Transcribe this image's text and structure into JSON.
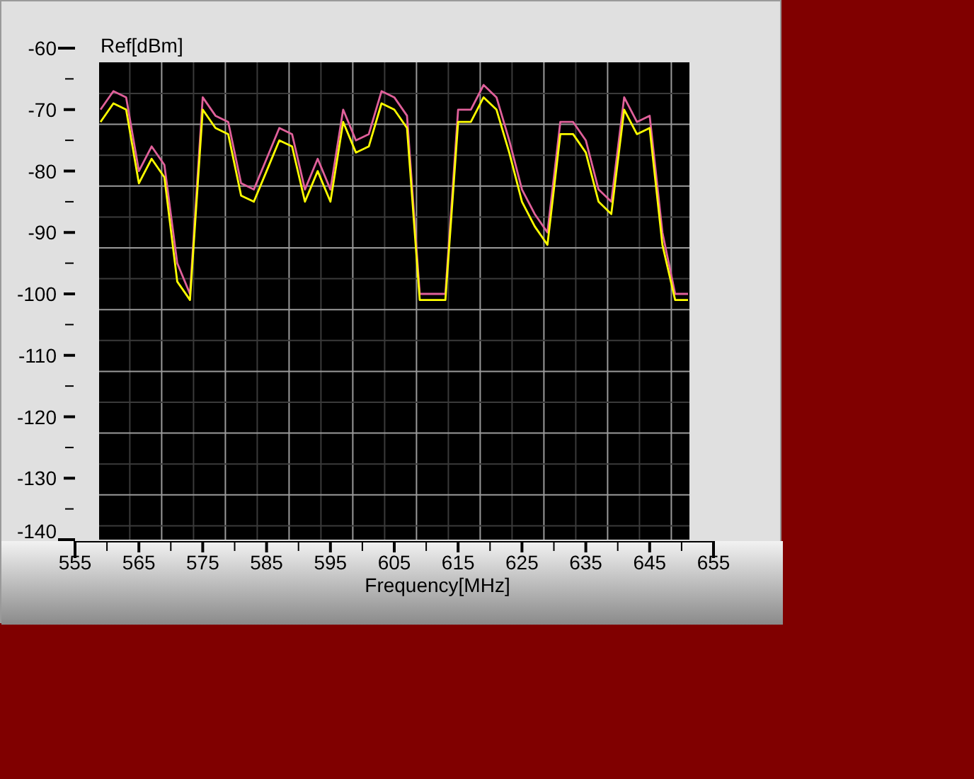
{
  "chart": {
    "chart_data": {
      "type": "line",
      "xlabel": "Frequency[MHz]",
      "ylabel": "Ref[dBm]",
      "x": [
        559,
        561,
        563,
        565,
        567,
        569,
        571,
        573,
        575,
        577,
        579,
        581,
        583,
        585,
        587,
        589,
        591,
        593,
        595,
        597,
        599,
        601,
        603,
        605,
        607,
        609,
        611,
        613,
        615,
        617,
        619,
        621,
        623,
        625,
        627,
        629,
        631,
        633,
        635,
        637,
        639,
        641,
        643,
        645,
        647,
        649,
        651
      ],
      "series": [
        {
          "color": "#e0609a",
          "values": [
            -70,
            -67,
            -68,
            -80,
            -76,
            -79,
            -95,
            -100,
            -68,
            -71,
            -72,
            -82,
            -83,
            -78,
            -73,
            -74,
            -83,
            -78,
            -83,
            -70,
            -75,
            -74,
            -67,
            -68,
            -71,
            -100,
            -100,
            -100,
            -70,
            -70,
            -66,
            -68,
            -75,
            -83,
            -87,
            -90,
            -72,
            -72,
            -75,
            -83,
            -85,
            -68,
            -72,
            -71,
            -90,
            -100,
            -100
          ]
        },
        {
          "color": "#ffff00",
          "values": [
            -72,
            -69,
            -70,
            -82,
            -78,
            -81,
            -98,
            -101,
            -70,
            -73,
            -74,
            -84,
            -85,
            -80,
            -75,
            -76,
            -85,
            -80,
            -85,
            -72,
            -77,
            -76,
            -69,
            -70,
            -73,
            -101,
            -101,
            -101,
            -72,
            -72,
            -68,
            -70,
            -77,
            -85,
            -89,
            -92,
            -74,
            -74,
            -77,
            -85,
            -87,
            -70,
            -74,
            -73,
            -92,
            -101,
            -101
          ]
        }
      ],
      "xlim": [
        555,
        655
      ],
      "ylim": [
        -140,
        -60
      ],
      "xticks": [
        555,
        565,
        575,
        585,
        595,
        605,
        615,
        625,
        635,
        645,
        655
      ],
      "yticks": [
        -60,
        -70,
        -80,
        -90,
        -100,
        -110,
        -120,
        -130,
        -140
      ]
    }
  }
}
